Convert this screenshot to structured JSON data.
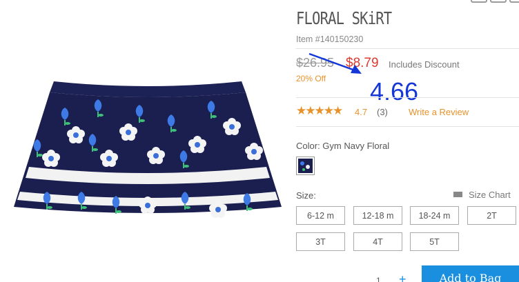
{
  "product": {
    "title": "FLORAL SKiRT",
    "item_number": "Item #140150230",
    "original_price": "$26.95",
    "sale_price": "$8.79",
    "discount_note": "Includes Discount",
    "percent_off": "20% Off",
    "annotation": "4.66",
    "stars": "★★★★★",
    "rating": "4.7",
    "review_count": "(3)",
    "write_review": "Write a Review",
    "color_label": "Color: Gym Navy Floral",
    "size_label": "Size:",
    "size_chart": "Size Chart",
    "sizes": [
      "6-12 m",
      "12-18 m",
      "18-24 m",
      "2T",
      "3T",
      "4T",
      "5T"
    ],
    "quantity": "1",
    "qty_plus": "+",
    "add_to_bag": "Add to Bag"
  },
  "colors": {
    "accent": "#1a8fe0",
    "sale": "#e0382c",
    "orange": "#e8922a",
    "annotation": "#1437d8",
    "skirt_navy": "#1a1f4f"
  }
}
